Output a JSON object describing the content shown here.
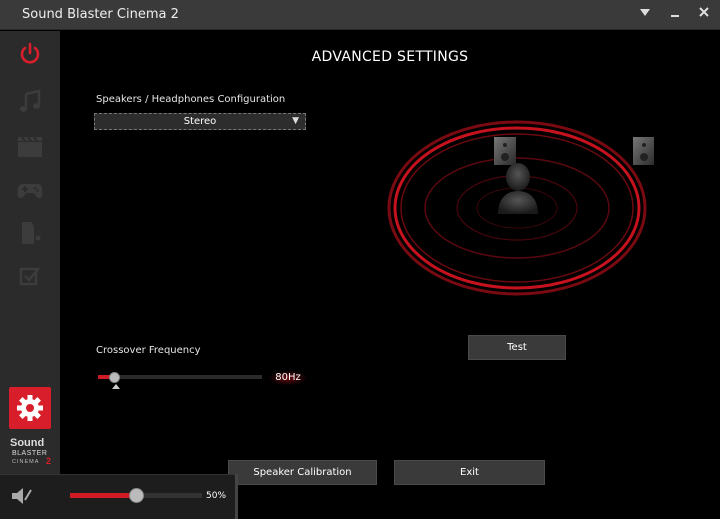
{
  "window": {
    "title": "Sound Blaster Cinema 2",
    "controls": {
      "dropdown_icon": "triangle-down-icon",
      "minimize_icon": "minimize-icon",
      "close_icon": "close-icon"
    }
  },
  "sidebar": {
    "items": [
      {
        "icon": "power-icon",
        "active": true
      },
      {
        "icon": "music-note-icon"
      },
      {
        "icon": "clapperboard-icon"
      },
      {
        "icon": "gamepad-icon"
      },
      {
        "icon": "voice-icon"
      },
      {
        "icon": "checkbox-icon"
      }
    ],
    "settings_icon": "gear-icon",
    "logo": {
      "line1": "Sound",
      "line2": "BLASTER",
      "line3": "CINEMA",
      "version": "2"
    }
  },
  "main": {
    "title": "ADVANCED SETTINGS",
    "speaker_config": {
      "label": "Speakers / Headphones Configuration",
      "selected": "Stereo"
    },
    "test_button": "Test",
    "crossover": {
      "label": "Crossover Frequency",
      "value_label": "80Hz",
      "level": 0.1
    },
    "buttons": {
      "calibration": "Speaker Calibration",
      "exit": "Exit"
    }
  },
  "volume": {
    "icon": "speaker-mute-icon",
    "value_label": "50%",
    "level": 0.5
  },
  "colors": {
    "accent": "#d81e2b",
    "titlebar": "#3a3a3a",
    "sidebar": "#2b2b2b",
    "button": "#3a3a3a"
  }
}
